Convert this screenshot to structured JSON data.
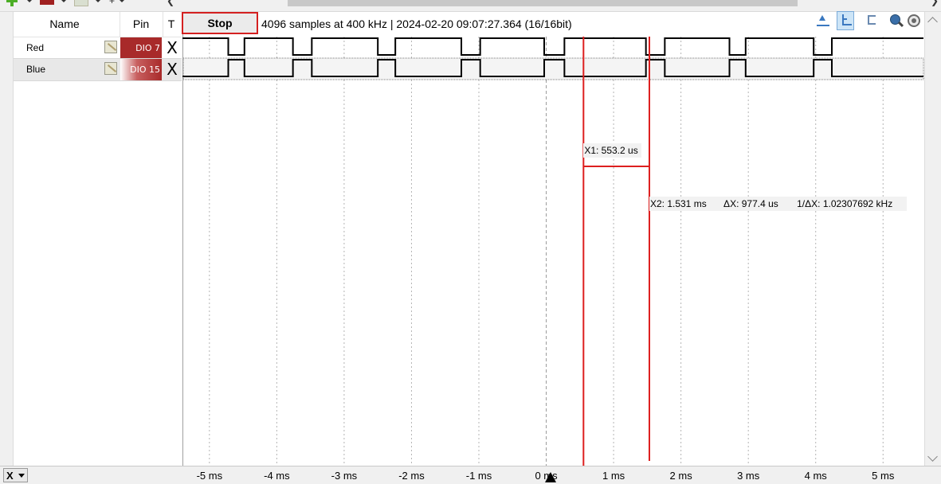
{
  "channel_table": {
    "headers": {
      "name": "Name",
      "pin": "Pin",
      "trigger": "T"
    },
    "channels": [
      {
        "name": "Red",
        "pin": "DIO  7",
        "trigger": "X"
      },
      {
        "name": "Blue",
        "pin": "DIO 15",
        "trigger": "X"
      }
    ]
  },
  "acquisition": {
    "stop_label": "Stop",
    "status": "4096 samples at 400 kHz | 2024-02-20 09:07:27.364 (16/16bit)"
  },
  "cursors": {
    "x1_label": "X1: 553.2 us",
    "x2_label": "X2: 1.531 ms",
    "dx_label": "ΔX: 977.4 us",
    "inv_dx_label": "1/ΔX: 1.02307692 kHz"
  },
  "x_axis": {
    "selector": "X",
    "ticks": [
      "-5 ms",
      "-4 ms",
      "-3 ms",
      "-2 ms",
      "-1 ms",
      "0 ms",
      "1 ms",
      "2 ms",
      "3 ms",
      "4 ms",
      "5 ms"
    ]
  },
  "waveforms": {
    "period_ms": 1.25,
    "red": [
      {
        "x": -5.0,
        "v": 1
      },
      {
        "x": -4.72,
        "v": 0
      },
      {
        "x": -4.48,
        "v": 1
      },
      {
        "x": -3.76,
        "v": 0
      },
      {
        "x": -3.48,
        "v": 1
      },
      {
        "x": -2.5,
        "v": 0
      },
      {
        "x": -2.24,
        "v": 1
      },
      {
        "x": -1.26,
        "v": 0
      },
      {
        "x": -0.98,
        "v": 1
      },
      {
        "x": -0.03,
        "v": 0
      },
      {
        "x": 0.27,
        "v": 1
      },
      {
        "x": 1.48,
        "v": 0
      },
      {
        "x": 1.76,
        "v": 1
      },
      {
        "x": 2.72,
        "v": 0
      },
      {
        "x": 2.96,
        "v": 1
      },
      {
        "x": 3.97,
        "v": 0
      },
      {
        "x": 4.24,
        "v": 1
      }
    ],
    "blue": [
      {
        "x": -5.0,
        "v": 0
      },
      {
        "x": -4.72,
        "v": 1
      },
      {
        "x": -4.48,
        "v": 0
      },
      {
        "x": -3.76,
        "v": 1
      },
      {
        "x": -3.48,
        "v": 0
      },
      {
        "x": -2.5,
        "v": 1
      },
      {
        "x": -2.24,
        "v": 0
      },
      {
        "x": -1.26,
        "v": 1
      },
      {
        "x": -0.98,
        "v": 0
      },
      {
        "x": -0.03,
        "v": 1
      },
      {
        "x": 0.27,
        "v": 0
      },
      {
        "x": 1.48,
        "v": 1
      },
      {
        "x": 1.76,
        "v": 0
      },
      {
        "x": 2.72,
        "v": 1
      },
      {
        "x": 2.96,
        "v": 0
      },
      {
        "x": 3.97,
        "v": 1
      },
      {
        "x": 4.24,
        "v": 0
      }
    ],
    "cursor_x1_ms": 0.5532,
    "cursor_x2_ms": 1.531,
    "x_range_ms": [
      -5,
      5
    ],
    "cursor_color": "#dd1f1f",
    "trace_color": "#000000"
  }
}
